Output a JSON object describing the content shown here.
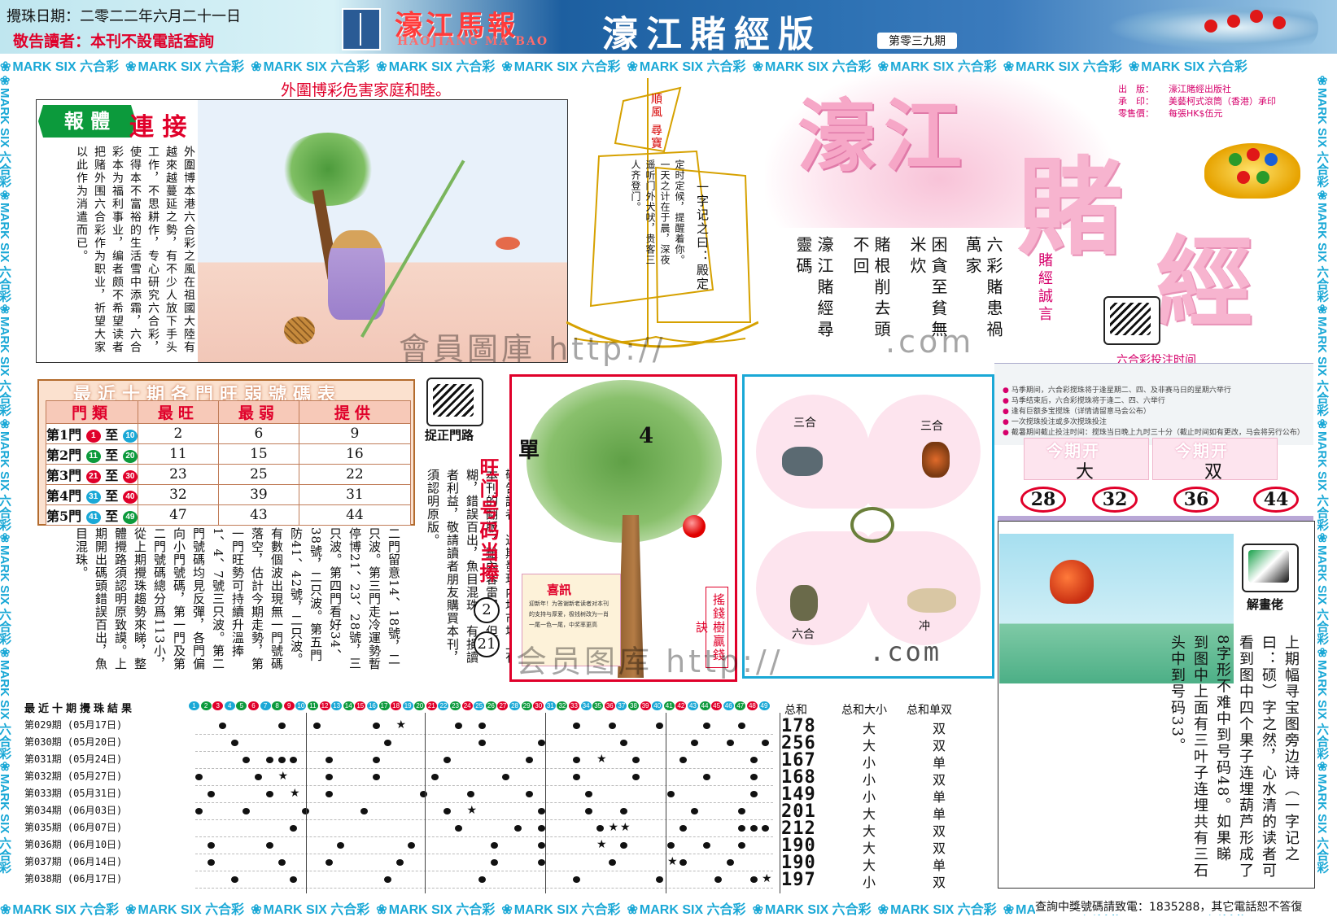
{
  "header": {
    "date": "攪珠日期：二零二二年六月二十一日",
    "notice": "敬告讀者：本刊不設電話查詢",
    "title_cn": "濠江馬報",
    "title_en": "HAOJIANG MA BAO",
    "edition": "濠江賭經版",
    "issue": "第零三九期"
  },
  "border_unit": {
    "text": "MARK SIX 六合彩",
    "flower": "❀",
    "repeat": 10
  },
  "headline": "外圍博彩危害家庭和睦。",
  "comic": {
    "badge": "報 體",
    "badge_suffix": "連 接",
    "text": "外圍博本港六合彩之風在祖國大陸有越來越蔓延之勢，有不少人放下手头工作，不思耕作，专心研究六合彩，使得本不富裕的生活雪中添霜，六合彩本为福利事业，编者颇不希望读者把赌外围六合彩作为职业，祈望大家以此作为消遣而已。"
  },
  "boat": {
    "flag": "順風 尋寶",
    "poem": "定时定候，提醒着你。一天之计在于晨，深夜遥听门外犬吠，贵客三人齐登门。",
    "riddle": "一字记之曰：殿定"
  },
  "logo": {
    "a": "濠江",
    "b": "賭",
    "c": "經"
  },
  "publisher": [
    {
      "label": "出　版：",
      "value": "濠江賭經出版社"
    },
    {
      "label": "承　印：",
      "value": "美藝柯式滾筒（香港）承印"
    },
    {
      "label": "零售價：",
      "value": "每張HK$伍元"
    }
  ],
  "verses": [
    "六彩賭患禍萬家",
    "困貪至貧無米炊",
    "賭根削去頭不回",
    "濠江賭經尋靈碼"
  ],
  "motto": "賭經誠言",
  "watermark": {
    "a": "會員圖庫 http://",
    "b": ".com",
    "c": "会员图库 http://"
  },
  "lottery_time": {
    "title": "六合彩投注时间",
    "lines": [
      "马季期间，六合彩搅珠将于逢星期二、四、及非赛马日的星期六举行",
      "马季结束后，六合彩搅珠将于逢二、四、六举行",
      "逢有巨额多宝搅珠（详情请留意马会公布）",
      "一次搅珠投注或多次搅珠投注",
      "截暑期间截止投注时间：搅珠当日晚上九时三十分（截止时间如有更改，马会将另行公布）"
    ]
  },
  "open_result": {
    "title": "今期开",
    "values": [
      "大",
      "双"
    ],
    "hot_numbers": [
      "28",
      "32",
      "36",
      "44"
    ]
  },
  "stats": {
    "title": "最近十期各門旺弱號碼表",
    "headers": [
      "門類",
      "最旺",
      "最弱",
      "提供"
    ],
    "rows": [
      {
        "gate": "第1門",
        "from": "1",
        "to": "10",
        "hot": "2",
        "cold": "6",
        "tip": "9"
      },
      {
        "gate": "第2門",
        "from": "11",
        "to": "20",
        "hot": "11",
        "cold": "15",
        "tip": "16"
      },
      {
        "gate": "第3門",
        "from": "21",
        "to": "30",
        "hot": "23",
        "cold": "25",
        "tip": "22"
      },
      {
        "gate": "第4門",
        "from": "31",
        "to": "40",
        "hot": "32",
        "cold": "39",
        "tip": "31"
      },
      {
        "gate": "第5門",
        "from": "41",
        "to": "49",
        "hot": "47",
        "cold": "43",
        "tip": "44"
      }
    ],
    "gate_word": "至"
  },
  "icon_labels": {
    "gate": "捉正門路",
    "solve": "解畫佬"
  },
  "article": "二門留意14、18號，二只波。第三門走冷運勢暫停博21、23、28號，三只波。第四門看好34、38號，二只波。第五門防41、42號，二只波。有數個波出現無一門號碼落空，估計今期走勢，第一門旺勢可持續升溫捧1、4、7號三只波。第二門號碼均見反彈，各門偏向小門號碼，第一門及第二門號碼總分爲113小，從上期攪珠趨勢來睇，整體攪路須認明原致謨。上期開出碼頭錯誤百出，魚目混珠。",
  "article2": "敬告讀者：近期發現內地市場上有本刊的翻版，雖內容雷同，但模糊，錯誤百出，魚目混珠。有損讀者利益，敬請讀者朋友購買本刊，須認明原版。",
  "hot_title": "旺门号码当捧",
  "hot_picks": [
    "2",
    "21"
  ],
  "tree": {
    "single": "單",
    "num": "4",
    "news_title": "喜訊",
    "news_text": "迎新年！为答谢新老读者对本刊的支持与厚爱，极钱树改为一肖一尾一色一尾，中奖率更高",
    "side": "搖錢樹贏錢訣"
  },
  "zodiac": {
    "labels": [
      "三合",
      "三合",
      "六合",
      "冲"
    ],
    "com": ".com"
  },
  "rbox": {
    "riddle": "上期幅寻宝图旁边诗（一字记之曰：硕）字之然，心水清的读者可看到图中四个果子连埋葫芦形成了8字形不难中到号码48。如果睇到图中上面有三叶子连埋共有三石头中到号码33。"
  },
  "draws": {
    "title": "最近十期攪珠結果",
    "heads": [
      "总和",
      "总和大小",
      "总和单双"
    ],
    "rows": [
      {
        "issue": "第029期",
        "date": "(05月17日)",
        "sum": "178",
        "size": "大",
        "odd": "双",
        "dots": [
          3,
          8,
          11,
          16,
          23,
          25,
          33,
          36,
          40,
          44,
          47
        ],
        "stars": [
          18
        ]
      },
      {
        "issue": "第030期",
        "date": "(05月20日)",
        "sum": "256",
        "size": "大",
        "odd": "双",
        "dots": [
          4,
          17,
          25,
          30,
          37,
          43,
          46,
          49
        ],
        "stars": []
      },
      {
        "issue": "第031期",
        "date": "(05月24日)",
        "sum": "167",
        "size": "小",
        "odd": "单",
        "dots": [
          5,
          7,
          8,
          9,
          12,
          16,
          22,
          29,
          33,
          38,
          42,
          48
        ],
        "stars": [
          35
        ]
      },
      {
        "issue": "第032期",
        "date": "(05月27日)",
        "sum": "168",
        "size": "小",
        "odd": "双",
        "dots": [
          1,
          6,
          12,
          16,
          21,
          27,
          33,
          38,
          44,
          48
        ],
        "stars": [
          8
        ]
      },
      {
        "issue": "第033期",
        "date": "(05月31日)",
        "sum": "149",
        "size": "小",
        "odd": "单",
        "dots": [
          2,
          7,
          12,
          20,
          24,
          29,
          34,
          41,
          48
        ],
        "stars": [
          9
        ]
      },
      {
        "issue": "第034期",
        "date": "(06月03日)",
        "sum": "201",
        "size": "大",
        "odd": "单",
        "dots": [
          1,
          5,
          10,
          15,
          22,
          30,
          34,
          37,
          43,
          47
        ],
        "stars": [
          24
        ]
      },
      {
        "issue": "第035期",
        "date": "(06月07日)",
        "sum": "212",
        "size": "大",
        "odd": "双",
        "dots": [
          9,
          23,
          28,
          30,
          35,
          42,
          47,
          48,
          49
        ],
        "stars": [
          36,
          37
        ]
      },
      {
        "issue": "第036期",
        "date": "(06月10日)",
        "sum": "190",
        "size": "大",
        "odd": "双",
        "dots": [
          2,
          7,
          13,
          19,
          26,
          30,
          37,
          41,
          44,
          47
        ],
        "stars": [
          35
        ]
      },
      {
        "issue": "第037期",
        "date": "(06月14日)",
        "sum": "190",
        "size": "大",
        "odd": "单",
        "dots": [
          2,
          8,
          12,
          18,
          26,
          30,
          36,
          42,
          46
        ],
        "stars": [
          41
        ]
      },
      {
        "issue": "第038期",
        "date": "(06月17日)",
        "sum": "197",
        "size": "小",
        "odd": "双",
        "dots": [
          4,
          9,
          17,
          25,
          33,
          40,
          45,
          48
        ],
        "stars": [
          49
        ]
      }
    ]
  },
  "footer": "查詢中獎號碼請致電：1835288，其它電話恕不答復",
  "colors": {
    "red": "#e0002a",
    "blue": "#1aa8d6",
    "green": "#0c9a3c",
    "pink": "#f6a7c7"
  }
}
